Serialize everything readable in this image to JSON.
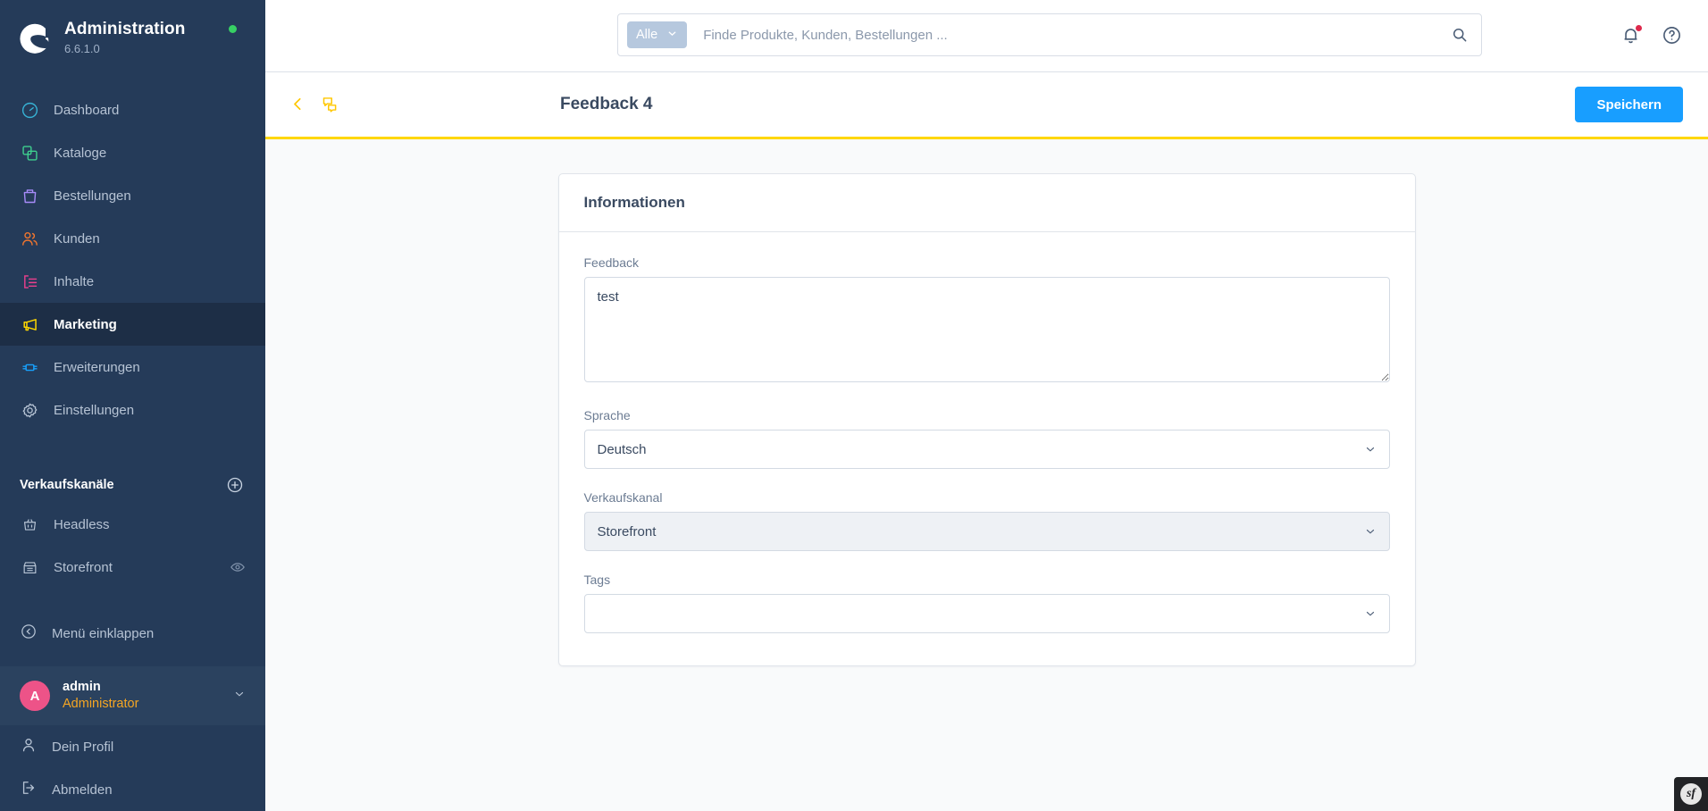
{
  "sidebar": {
    "brand": {
      "title": "Administration",
      "version": "6.6.1.0",
      "logo_icon": "shopware-logo",
      "status_dot": "online-status-dot"
    },
    "nav": [
      {
        "label": "Dashboard",
        "icon": "dashboard-icon",
        "color": "#37b3d6",
        "active": false
      },
      {
        "label": "Kataloge",
        "icon": "catalog-icon",
        "color": "#3ecf8e",
        "active": false
      },
      {
        "label": "Bestellungen",
        "icon": "orders-bag-icon",
        "color": "#a78bfa",
        "active": false
      },
      {
        "label": "Kunden",
        "icon": "customers-icon",
        "color": "#f2762e",
        "active": false
      },
      {
        "label": "Inhalte",
        "icon": "content-icon",
        "color": "#ed3f8e",
        "active": false
      },
      {
        "label": "Marketing",
        "icon": "megaphone-icon",
        "color": "#ffd700",
        "active": true
      },
      {
        "label": "Erweiterungen",
        "icon": "plugin-icon",
        "color": "#18a0fb",
        "active": false
      },
      {
        "label": "Einstellungen",
        "icon": "gear-icon",
        "color": "#b6c3d4",
        "active": false
      }
    ],
    "sales_channels": {
      "section_title": "Verkaufskanäle",
      "add_label": "add-sales-channel",
      "items": [
        {
          "label": "Headless",
          "icon": "basket-icon",
          "has_eye": false
        },
        {
          "label": "Storefront",
          "icon": "storefront-icon",
          "has_eye": true
        }
      ]
    },
    "collapse": {
      "label": "Menü einklappen",
      "icon": "chevron-left-circle-icon"
    },
    "user": {
      "initial": "A",
      "name": "admin",
      "role": "Administrator",
      "chevron_icon": "chevron-down-icon"
    },
    "footer": [
      {
        "label": "Dein Profil",
        "icon": "user-icon"
      },
      {
        "label": "Abmelden",
        "icon": "logout-icon"
      }
    ]
  },
  "topbar": {
    "search": {
      "scope_label": "Alle",
      "scope_chevron_icon": "chevron-down-icon",
      "placeholder": "Finde Produkte, Kunden, Bestellungen ...",
      "value": "",
      "submit_icon": "search-icon"
    },
    "notifications_icon": "bell-icon",
    "has_notification_badge": true,
    "help_icon": "help-circle-icon"
  },
  "pagehead": {
    "back_icon": "chevron-left-icon",
    "duplicate_icon": "speech-bubbles-icon",
    "title": "Feedback 4",
    "save_label": "Speichern",
    "accent_color": "#ffd700",
    "save_color": "#189eff"
  },
  "card": {
    "title": "Informationen",
    "fields": {
      "feedback": {
        "label": "Feedback",
        "value": "test",
        "placeholder": ""
      },
      "language": {
        "label": "Sprache",
        "value": "Deutsch",
        "chevron_icon": "chevron-down-icon",
        "disabled": false
      },
      "sales_channel": {
        "label": "Verkaufskanal",
        "value": "Storefront",
        "chevron_icon": "chevron-down-icon",
        "disabled": true
      },
      "tags": {
        "label": "Tags",
        "value": "",
        "chevron_icon": "chevron-down-icon",
        "disabled": false
      }
    }
  },
  "debug_toolbar": {
    "label": "sf",
    "icon": "symfony-profiler-icon"
  }
}
